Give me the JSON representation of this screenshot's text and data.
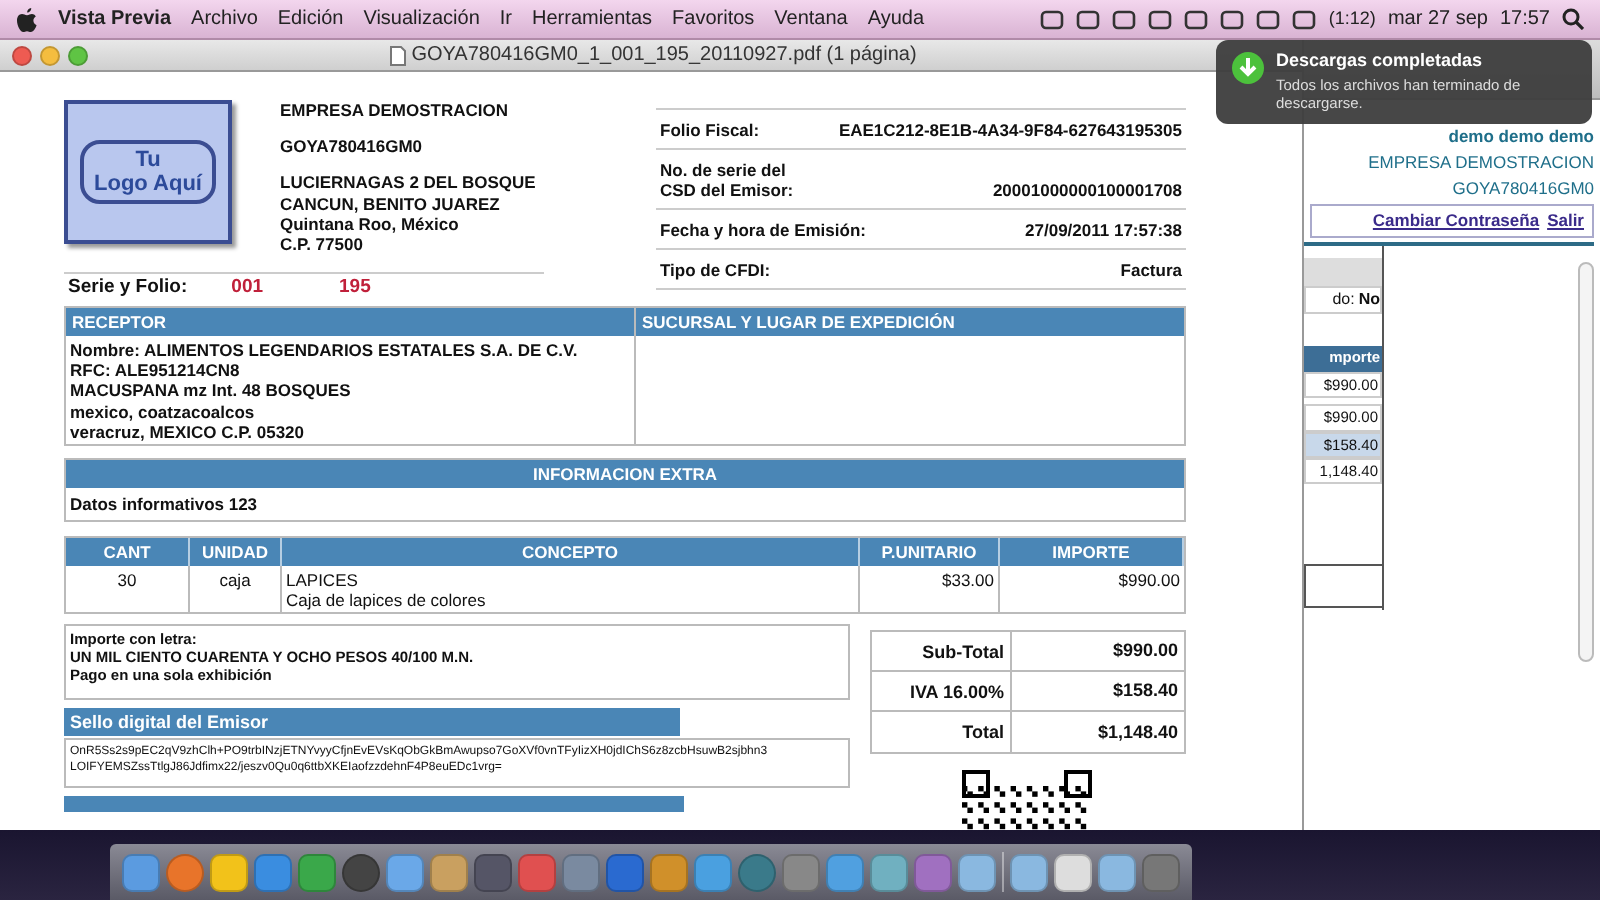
{
  "menubar": {
    "app": "Vista Previa",
    "menus": [
      "Archivo",
      "Edición",
      "Visualización",
      "Ir",
      "Herramientas",
      "Favoritos",
      "Ventana",
      "Ayuda"
    ],
    "battery": "(1:12)",
    "date": "mar 27 sep",
    "time": "17:57"
  },
  "window": {
    "title": "GOYA780416GM0_1_001_195_20110927.pdf (1 página)"
  },
  "invoice": {
    "logo_lines": [
      "Tu",
      "Logo Aquí"
    ],
    "issuer": {
      "name": "EMPRESA DEMOSTRACION",
      "rfc": "GOYA780416GM0",
      "address": [
        "LUCIERNAGAS 2  DEL BOSQUE",
        "CANCUN, BENITO JUAREZ",
        "Quintana Roo, México",
        "C.P. 77500"
      ]
    },
    "fiscal": [
      {
        "label": "Folio Fiscal:",
        "value": "EAE1C212-8E1B-4A34-9F84-627643195305"
      },
      {
        "label": "No. de serie del CSD del Emisor:",
        "value": "20001000000100001708"
      },
      {
        "label": "Fecha y hora de Emisión:",
        "value": "27/09/2011 17:57:38"
      },
      {
        "label": "Tipo de CFDI:",
        "value": "Factura"
      }
    ],
    "serie_folio": {
      "label": "Serie y Folio:",
      "serie": "001",
      "folio": "195"
    },
    "receptor": {
      "heading": "RECEPTOR",
      "lines": [
        "Nombre: ALIMENTOS LEGENDARIOS ESTATALES S.A. DE C.V.",
        "RFC: ALE951214CN8",
        "MACUSPANA mz Int. 48 BOSQUES",
        "mexico, coatzacoalcos",
        "veracruz, MEXICO C.P. 05320"
      ]
    },
    "sucursal": {
      "heading": "SUCURSAL Y LUGAR DE EXPEDICIÓN"
    },
    "extra": {
      "heading": "INFORMACION EXTRA",
      "text": "Datos informativos 123"
    },
    "items": {
      "columns": [
        "CANT",
        "UNIDAD",
        "CONCEPTO",
        "P.UNITARIO",
        "IMPORTE"
      ],
      "rows": [
        {
          "cant": "30",
          "unidad": "caja",
          "concepto": "LAPICES",
          "descripcion": "Caja de lapices de colores",
          "unitario": "$33.00",
          "importe": "$990.00"
        }
      ]
    },
    "amount_words": {
      "label": "Importe con letra:",
      "amount": "UN MIL CIENTO CUARENTA Y OCHO PESOS 40/100  M.N.",
      "payment": "Pago en una sola exhibición"
    },
    "totals": [
      {
        "label": "Sub-Total",
        "value": "$990.00"
      },
      {
        "label": "IVA 16.00%",
        "value": "$158.40"
      },
      {
        "label": "Total",
        "value": "$1,148.40"
      }
    ],
    "seal": {
      "heading": "Sello digital del Emisor",
      "lines": [
        "OnR5Ss2s9pEC2qV9zhClh+PO9trbINzjETNYvyyCfjnEvEVsKqObGkBmAwupso7GoXVf0vnTFyIizXH0jdIChS6z8zcbHsuwB2sjbhn3",
        "LOIFYEMSZssTtlgJ86Jdfimx22/jeszv0Qu0q6ttbXKEIaofzzdehnF4P8euEDc1vrg="
      ]
    }
  },
  "browser": {
    "user": "demo demo demo",
    "company": "EMPRESA DEMOSTRACION",
    "rfc": "GOYA780416GM0",
    "links": [
      "Cambiar Contraseña",
      "Salir"
    ],
    "field_fragment": "do:",
    "field_value": "No",
    "column_fragment": "mporte",
    "values": [
      "$990.00",
      "$990.00",
      "$158.40",
      "1,148.40"
    ]
  },
  "notification": {
    "title": "Descargas completadas",
    "body": "Todos los archivos han terminado de descargarse."
  }
}
